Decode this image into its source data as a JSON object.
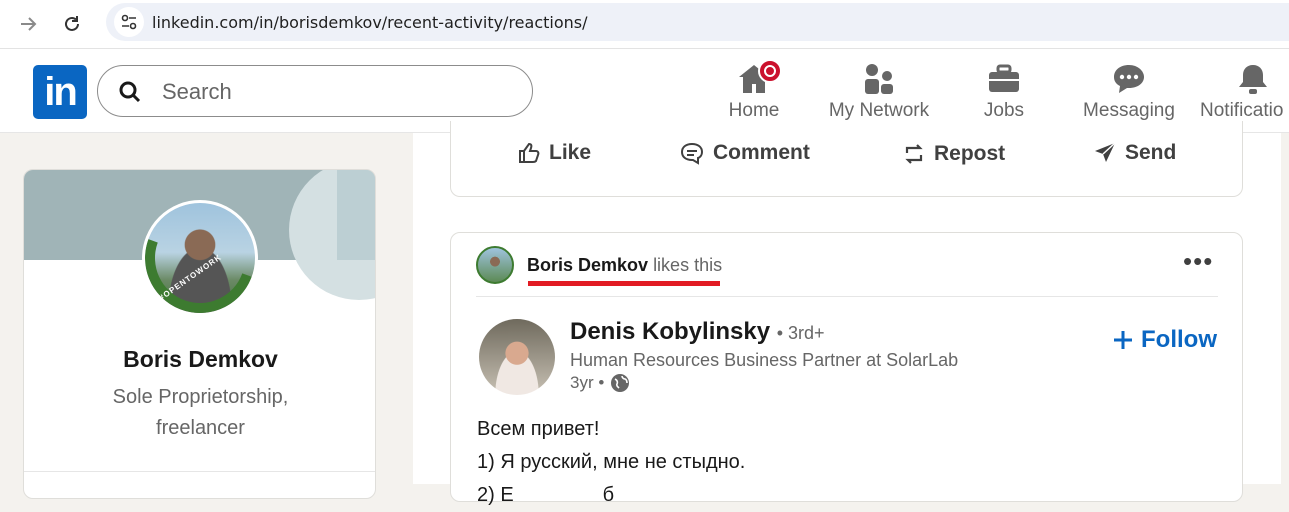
{
  "browser": {
    "url_host": "linkedin.com",
    "url_path": "/in/borisdemkov/recent-activity/reactions/"
  },
  "header": {
    "logo_text": "in",
    "search_placeholder": "Search",
    "nav": [
      {
        "label": "Home",
        "icon": "home-icon"
      },
      {
        "label": "My Network",
        "icon": "network-icon"
      },
      {
        "label": "Jobs",
        "icon": "briefcase-icon"
      },
      {
        "label": "Messaging",
        "icon": "messaging-icon"
      },
      {
        "label": "Notificatio",
        "icon": "bell-icon"
      }
    ]
  },
  "profile": {
    "name": "Boris Demkov",
    "headline": "Sole Proprietorship, freelancer",
    "badge_text": "#OPENTOWORK"
  },
  "actions": [
    {
      "label": "Like",
      "icon": "thumbs-up-icon"
    },
    {
      "label": "Comment",
      "icon": "comment-icon"
    },
    {
      "label": "Repost",
      "icon": "repost-icon"
    },
    {
      "label": "Send",
      "icon": "send-icon"
    }
  ],
  "post": {
    "reactor_name": "Boris Demkov",
    "reaction_text": "likes this",
    "more_label": "•••",
    "author_name": "Denis Kobylinsky",
    "author_degree": "• 3rd+",
    "author_title": "Human Resources Business Partner at SolarLab",
    "time": "3yr •",
    "follow_label": "Follow",
    "text_lines": [
      "Всем привет!",
      "1) Я русский, мне не стыдно.",
      "2) Е                б"
    ]
  },
  "colors": {
    "brand": "#0a66c2",
    "notification": "#cb112d",
    "highlight_underline": "#e21b23",
    "open_to_work": "#3d7b30"
  }
}
